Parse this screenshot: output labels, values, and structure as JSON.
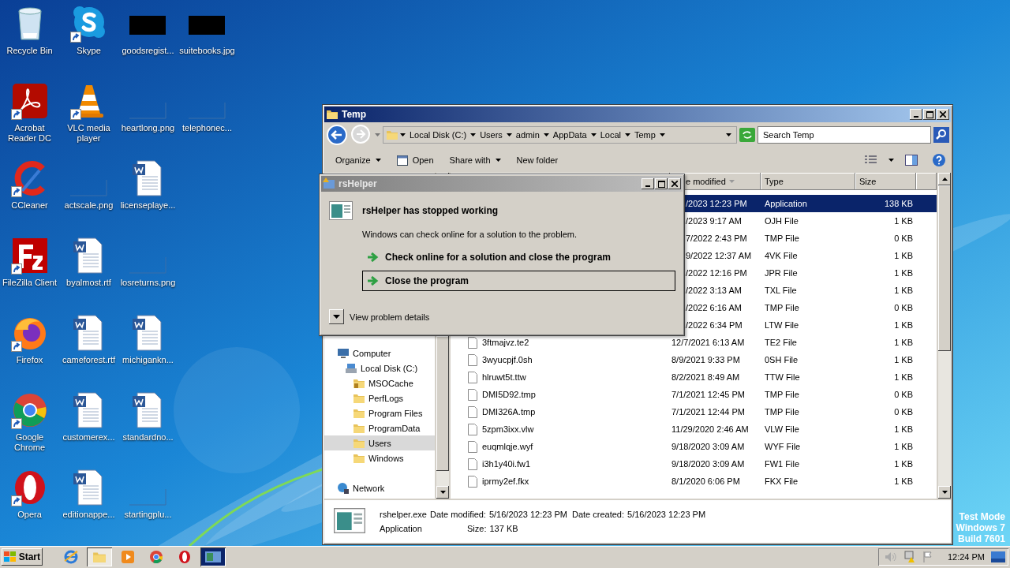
{
  "desktop": {
    "columns": [
      [
        {
          "label": "Recycle Bin",
          "kind": "recycle",
          "shortcut": false
        },
        {
          "label": "Acrobat Reader DC",
          "kind": "acrobat",
          "shortcut": true
        },
        {
          "label": "CCleaner",
          "kind": "ccleaner",
          "shortcut": true
        },
        {
          "label": "FileZilla Client",
          "kind": "filezilla",
          "shortcut": true
        },
        {
          "label": "Firefox",
          "kind": "firefox",
          "shortcut": true
        },
        {
          "label": "Google Chrome",
          "kind": "chrome",
          "shortcut": true
        },
        {
          "label": "Opera",
          "kind": "opera",
          "shortcut": true
        }
      ],
      [
        {
          "label": "Skype",
          "kind": "skype",
          "shortcut": true
        },
        {
          "label": "VLC media player",
          "kind": "vlc",
          "shortcut": true
        },
        {
          "label": "actscale.png",
          "shortcut": false
        },
        {
          "label": "byalmost.rtf",
          "kind": "document",
          "shortcut": false
        },
        {
          "label": "cameforest.rtf",
          "kind": "document",
          "shortcut": false
        },
        {
          "label": "customerex...",
          "kind": "document",
          "shortcut": false
        },
        {
          "label": "editionappe...",
          "kind": "document",
          "shortcut": false
        }
      ],
      [
        {
          "label": "goodsregist...",
          "kind": "dark-image",
          "shortcut": false
        },
        {
          "label": "heartlong.png",
          "shortcut": false
        },
        {
          "label": "licenseplaye...",
          "kind": "document",
          "shortcut": false
        },
        {
          "label": "losreturns.png",
          "shortcut": false
        },
        {
          "label": "michigankn...",
          "kind": "document",
          "shortcut": false
        },
        {
          "label": "standardno...",
          "kind": "document",
          "shortcut": false
        },
        {
          "label": "startingplu...",
          "shortcut": false
        }
      ],
      [
        {
          "label": "suitebooks.jpg",
          "kind": "dark-image",
          "shortcut": false
        },
        {
          "label": "telephonec...",
          "shortcut": false
        }
      ]
    ]
  },
  "explorer": {
    "title": "Temp",
    "active": true,
    "breadcrumbs": [
      "Local Disk (C:)",
      "Users",
      "admin",
      "AppData",
      "Local",
      "Temp"
    ],
    "search": {
      "placeholder": "Search Temp"
    },
    "toolbar": [
      {
        "label": "Organize",
        "kind": "menu"
      },
      {
        "label": "Open",
        "kind": "icon"
      },
      {
        "label": "Share with",
        "kind": "menu"
      },
      {
        "label": "New folder",
        "kind": "plain"
      }
    ],
    "nav": [
      {
        "label": "Computer",
        "kind": "computer",
        "selected": false,
        "children": [
          {
            "label": "Local Disk (C:)",
            "kind": "drive",
            "selected": false,
            "children": [
              {
                "label": "MSOCache",
                "kind": "locked-folder",
                "selected": false
              },
              {
                "label": "PerfLogs",
                "kind": "folder",
                "selected": false
              },
              {
                "label": "Program Files",
                "kind": "folder",
                "selected": false
              },
              {
                "label": "ProgramData",
                "kind": "folder",
                "selected": false
              },
              {
                "label": "Users",
                "kind": "folder",
                "selected": true
              },
              {
                "label": "Windows",
                "kind": "folder",
                "selected": false
              }
            ]
          }
        ]
      },
      {
        "label": "Network",
        "kind": "network",
        "selected": false
      }
    ],
    "columns": [
      "e modified",
      "Type",
      "Size"
    ],
    "files": [
      {
        "modified": "/2023 12:23 PM",
        "type": "Application",
        "size": "138 KB",
        "selected": true
      },
      {
        "modified": "/2023 9:17 AM",
        "type": "OJH File",
        "size": "1 KB",
        "selected": false
      },
      {
        "modified": "7/2022 2:43 PM",
        "type": "TMP File",
        "size": "0 KB",
        "selected": false
      },
      {
        "modified": "9/2022 12:37 AM",
        "type": "4VK File",
        "size": "1 KB",
        "selected": false
      },
      {
        "modified": "/2022 12:16 PM",
        "type": "JPR File",
        "size": "1 KB",
        "selected": false
      },
      {
        "modified": "/2022 3:13 AM",
        "type": "TXL File",
        "size": "1 KB",
        "selected": false
      },
      {
        "modified": "/2022 6:16 AM",
        "type": "TMP File",
        "size": "0 KB",
        "selected": false
      },
      {
        "modified": "/2022 6:34 PM",
        "type": "LTW File",
        "size": "1 KB",
        "selected": false
      },
      {
        "name": "3ftmajvz.te2",
        "modified": "12/7/2021 6:13 AM",
        "type": "TE2 File",
        "size": "1 KB",
        "selected": false
      },
      {
        "name": "3wyucpjf.0sh",
        "modified": "8/9/2021 9:33 PM",
        "type": "0SH File",
        "size": "1 KB",
        "selected": false
      },
      {
        "name": "hlruwt5t.ttw",
        "modified": "8/2/2021 8:49 AM",
        "type": "TTW File",
        "size": "1 KB",
        "selected": false
      },
      {
        "name": "DMI5D92.tmp",
        "modified": "7/1/2021 12:45 PM",
        "type": "TMP File",
        "size": "0 KB",
        "selected": false
      },
      {
        "name": "DMI326A.tmp",
        "modified": "7/1/2021 12:44 PM",
        "type": "TMP File",
        "size": "0 KB",
        "selected": false
      },
      {
        "name": "5zpm3ixx.vlw",
        "modified": "11/29/2020 2:46 AM",
        "type": "VLW File",
        "size": "1 KB",
        "selected": false
      },
      {
        "name": "euqmlqje.wyf",
        "modified": "9/18/2020 3:09 AM",
        "type": "WYF File",
        "size": "1 KB",
        "selected": false
      },
      {
        "name": "i3h1y40i.fw1",
        "modified": "9/18/2020 3:09 AM",
        "type": "FW1 File",
        "size": "1 KB",
        "selected": false
      },
      {
        "name": "iprmy2ef.fkx",
        "modified": "8/1/2020 6:06 PM",
        "type": "FKX File",
        "size": "1 KB",
        "selected": false
      }
    ],
    "details": {
      "name": "rshelper.exe",
      "type": "Application",
      "modified_label": "Date modified:",
      "modified": "5/16/2023 12:23 PM",
      "size_label": "Size:",
      "size": "137 KB",
      "created_label": "Date created:",
      "created": "5/16/2023 12:23 PM"
    }
  },
  "dialog": {
    "title": "rsHelper",
    "heading": "rsHelper has stopped working",
    "message": "Windows can check online for a solution to the problem.",
    "options": [
      {
        "label": "Check online for a solution and close the program",
        "focused": false
      },
      {
        "label": "Close the program",
        "focused": true
      }
    ],
    "details_toggle": "View problem details"
  },
  "test_mode": [
    "Test Mode",
    "Windows 7",
    "Build 7601"
  ],
  "taskbar": {
    "start": "Start",
    "apps": [
      {
        "kind": "ie",
        "active": false
      },
      {
        "kind": "explorer",
        "active": true
      },
      {
        "kind": "media",
        "active": false
      },
      {
        "kind": "chrome",
        "active": false
      },
      {
        "kind": "opera",
        "active": false
      },
      {
        "kind": "app",
        "active": true
      }
    ],
    "time": "12:24 PM"
  }
}
